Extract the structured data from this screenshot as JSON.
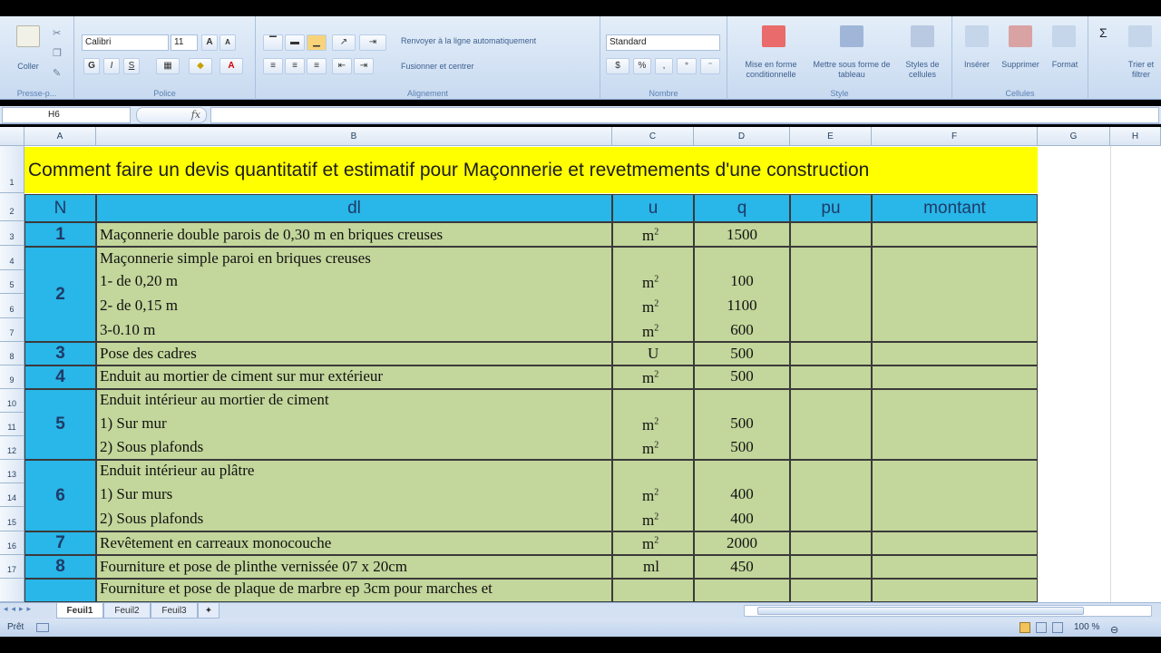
{
  "ribbon": {
    "clipboard": {
      "paste_label": "Coller",
      "title": "Presse-p..."
    },
    "font": {
      "name": "Calibri",
      "size": "11",
      "title": "Police",
      "bold": "G",
      "italic": "I",
      "underline": "S",
      "grow": "A",
      "shrink": "A",
      "color": "A"
    },
    "alignment": {
      "wrap": "Renvoyer à la ligne automatiquement",
      "merge": "Fusionner et centrer",
      "title": "Alignement"
    },
    "number": {
      "format": "Standard",
      "title": "Nombre"
    },
    "style": {
      "conditional": "Mise en forme conditionnelle",
      "table": "Mettre sous forme de tableau",
      "cell_styles": "Styles de cellules",
      "title": "Style"
    },
    "cells": {
      "insert": "Insérer",
      "delete": "Supprimer",
      "format": "Format",
      "title": "Cellules"
    },
    "editing": {
      "sort": "Trier et filtrer",
      "sigma": "Σ"
    }
  },
  "formula_bar": {
    "namebox": "H6",
    "fx": "fx",
    "value": ""
  },
  "sheet": {
    "columns": [
      "A",
      "B",
      "C",
      "D",
      "E",
      "F",
      "G",
      "H"
    ],
    "rows": [
      "1",
      "2",
      "3",
      "4",
      "5",
      "6",
      "7",
      "8",
      "9",
      "10",
      "11",
      "12",
      "13",
      "14",
      "15",
      "16",
      "17"
    ],
    "title": "Comment faire un devis quantitatif et estimatif pour Maçonnerie et revetmements d'une construction",
    "headers": {
      "n": "N",
      "dl": "dl",
      "u": "u",
      "q": "q",
      "pu": "pu",
      "montant": "montant"
    },
    "items": {
      "n1": "1",
      "d1": "Maçonnerie double parois de 0,30 m en briques creuses",
      "u1": "m",
      "q1": "1500",
      "n2": "2",
      "d2a": "Maçonnerie simple paroi en briques creuses",
      "d2b": "1- de 0,20 m",
      "d2c": "2- de 0,15 m",
      "d2d": "3-0.10 m",
      "u2b": "m",
      "u2c": "m",
      "u2d": "m",
      "q2b": "100",
      "q2c": "1100",
      "q2d": "600",
      "n3": "3",
      "d3": "Pose  des cadres",
      "u3": "U",
      "q3": "500",
      "n4": "4",
      "d4": "Enduit au mortier de ciment sur mur extérieur",
      "u4": "m",
      "q4": "500",
      "n5": "5",
      "d5a": "Enduit intérieur au mortier de ciment",
      "d5b": "1) Sur mur",
      "d5c": "2) Sous plafonds",
      "u5b": "m",
      "u5c": "m",
      "q5b": "500",
      "q5c": "500",
      "n6": "6",
      "d6a": "Enduit intérieur au plâtre",
      "d6b": "1) Sur murs",
      "d6c": "2) Sous plafonds",
      "u6b": "m",
      "u6c": "m",
      "q6b": "400",
      "q6c": "400",
      "n7": "7",
      "d7": "Revêtement en carreaux monocouche",
      "u7": "m",
      "q7": "2000",
      "n8": "8",
      "d8": "Fourniture et pose de plinthe vernissée 07 x 20cm",
      "u8": "ml",
      "q8": "450",
      "d9": "Fourniture et pose de plaque de marbre ep 3cm pour marches et"
    },
    "sup": "2"
  },
  "tabs": [
    "Feuil1",
    "Feuil2",
    "Feuil3"
  ],
  "status": {
    "ready": "Prêt",
    "zoom": "100 %"
  },
  "colors": {
    "cyan": "#29b6e8",
    "green": "#c3d69b",
    "yellow": "#ffff00"
  }
}
